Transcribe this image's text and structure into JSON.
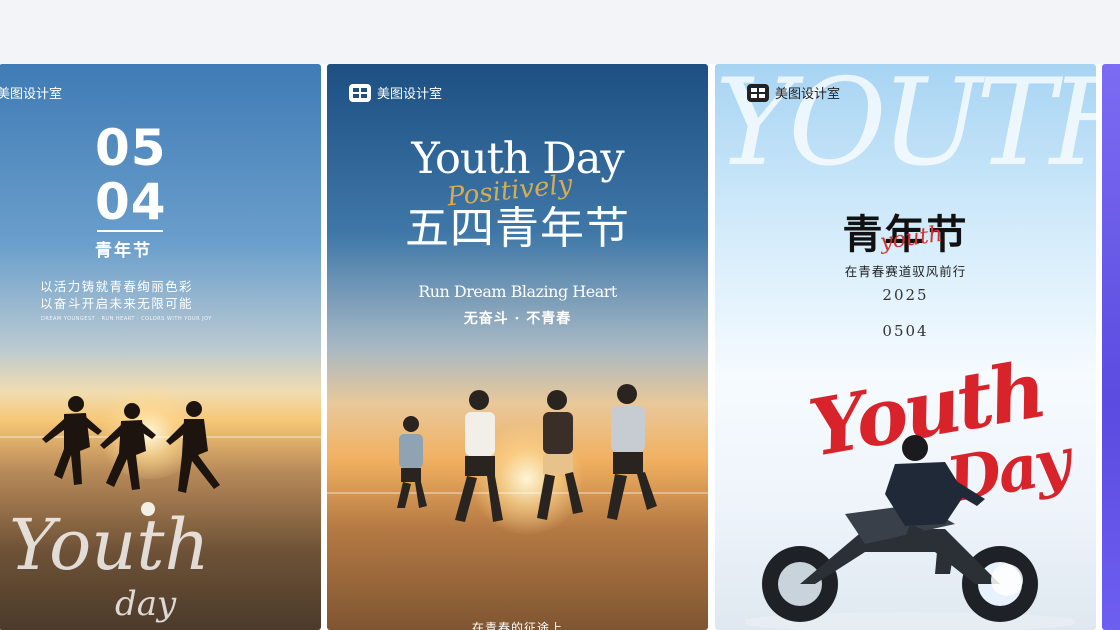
{
  "gallery": {
    "cards": [
      {
        "brand": "美图设计室",
        "date_top": "05",
        "date_bottom": "04",
        "festival": "青年节",
        "slogan_1": "以活力铸就青春绚丽色彩",
        "slogan_2": "以奋斗开启未来无限可能",
        "fine_print": "DREAM YOUNGEST · RUN HEART · COLORS WITH YOUR JOY",
        "script": "Youth",
        "script_small": "day"
      },
      {
        "brand": "美图设计室",
        "title_en": "Youth Day",
        "script": "Positively",
        "title_cn": "五四青年节",
        "subtitle_en": "Run Dream  Blazing Heart",
        "subtitle_cn": "无奋斗 · 不青春",
        "bottom_text": "在青春的征途上"
      },
      {
        "brand": "美图设计室",
        "bg_word": "YOUTH",
        "title_cn": "青年节",
        "title_script": "youth",
        "subtitle": "在青春赛道驭风前行",
        "year": "2025",
        "date": "0504",
        "red_line_1": "Youth",
        "red_line_2": "Day"
      }
    ]
  },
  "colors": {
    "accent_red": "#d8232a",
    "script_gold": "#e8b34a",
    "side_card_purple": "#6d5ff0"
  },
  "icons": {
    "brand": "meitu-logo-icon"
  }
}
